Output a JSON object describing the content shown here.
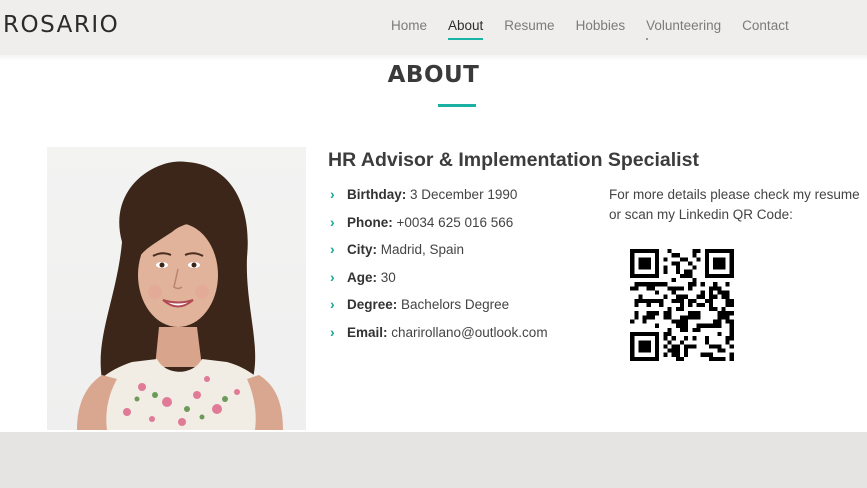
{
  "brand": "ROSARIO",
  "nav": {
    "items": [
      "Home",
      "About",
      "Resume",
      "Hobbies",
      "Volunteering",
      "Contact"
    ],
    "active": "About"
  },
  "about": {
    "heading": "ABOUT",
    "role": "HR Advisor & Implementation Specialist",
    "facts": [
      {
        "label": "Birthday:",
        "value": "3 December 1990"
      },
      {
        "label": "Phone:",
        "value": "+0034 625 016 566"
      },
      {
        "label": "City:",
        "value": "Madrid, Spain"
      },
      {
        "label": "Age:",
        "value": "30"
      },
      {
        "label": "Degree:",
        "value": "Bachelors Degree"
      },
      {
        "label": "Email:",
        "value": "charirollano@outlook.com"
      }
    ],
    "qr_note": "For more details please check my resume or scan my Linkedin QR Code:"
  },
  "colors": {
    "accent": "#1ab1a2",
    "header_bg": "#efeeed",
    "page_bg": "#e5e4e3"
  },
  "icons": {
    "fact_bullet": "chevron-right-icon",
    "qr": "qr-code"
  }
}
